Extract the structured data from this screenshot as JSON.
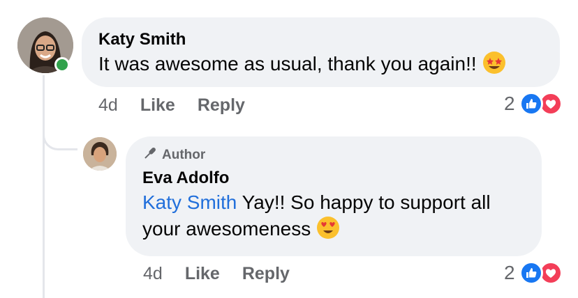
{
  "comment": {
    "author": "Katy Smith",
    "text": "It was awesome as usual, thank you again!!",
    "emoji": "star-struck-emoji",
    "time": "4d",
    "like_label": "Like",
    "reply_label": "Reply",
    "reaction_count": "2",
    "online": true
  },
  "reply": {
    "badge": "Author",
    "author": "Eva Adolfo",
    "mention": "Katy Smith",
    "text_line1": " Yay!! So happy to support all",
    "text_line2": "your awesomeness",
    "emoji": "heart-eyes-emoji",
    "time": "4d",
    "like_label": "Like",
    "reply_label": "Reply",
    "reaction_count": "2"
  },
  "colors": {
    "bubble": "#f0f2f5",
    "mention": "#216fdb",
    "meta": "#65676b",
    "like": "#1877f2",
    "love": "#f33e58",
    "online": "#31a24c"
  }
}
